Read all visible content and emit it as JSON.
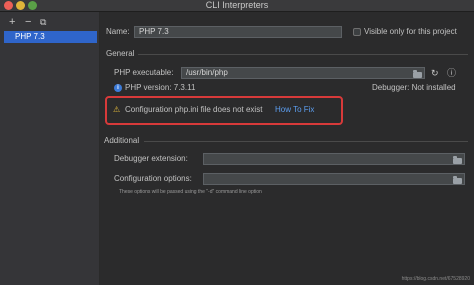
{
  "window": {
    "title": "CLI Interpreters"
  },
  "sidebar": {
    "tools": {
      "add": "+",
      "remove": "−",
      "copy": "⧉"
    },
    "items": [
      {
        "label": "PHP 7.3",
        "selected": true
      }
    ]
  },
  "form": {
    "name_label": "Name:",
    "name_value": "PHP 7.3",
    "visible_only_label": "Visible only for this project",
    "visible_only_checked": false
  },
  "general": {
    "section_label": "General",
    "php_exec_label": "PHP executable:",
    "php_exec_value": "/usr/bin/php",
    "php_version_text": "PHP version: 7.3.11",
    "debugger_text": "Debugger: Not installed",
    "warning_text": "Configuration php.ini file does not exist",
    "how_to_fix": "How To Fix"
  },
  "additional": {
    "section_label": "Additional",
    "debugger_ext_label": "Debugger extension:",
    "debugger_ext_value": "",
    "config_options_label": "Configuration options:",
    "config_options_value": "",
    "hint_text": "These options will be passed using the \"-d\" command line option"
  },
  "watermark": "https://blog.csdn.net/67528920",
  "colors": {
    "accent": "#2f65ca",
    "link": "#5c9ef0",
    "warning": "#e2b93b",
    "highlight_box": "#d83a3a"
  }
}
